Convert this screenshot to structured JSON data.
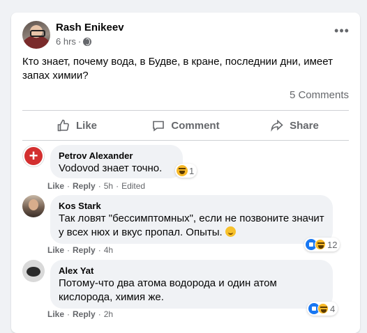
{
  "post": {
    "author": "Rash Enikeev",
    "time": "6 hrs",
    "separator": "·",
    "text": "Кто знает, почему вода, в Будве, в кране, последнии дни, имеет запах химии?",
    "comment_count": "5 Comments",
    "more_label": "•••"
  },
  "actions": {
    "like": "Like",
    "comment": "Comment",
    "share": "Share"
  },
  "comments": [
    {
      "name": "Petrov Alexander",
      "text": "Vodovod знает точно.",
      "reaction_count": "1",
      "like": "Like",
      "reply": "Reply",
      "time": "5h",
      "edited": "Edited"
    },
    {
      "name": "Kos Stark",
      "text": "Так ловят \"бессимптомных\", если не позвоните значит у всех нюх и вкус пропал. Опыты.",
      "reaction_count": "12",
      "like": "Like",
      "reply": "Reply",
      "time": "4h"
    },
    {
      "name": "Alex Yat",
      "text": "Потому-что два атома водорода и один атом кислорода, химия же.",
      "reaction_count": "4",
      "like": "Like",
      "reply": "Reply",
      "time": "2h"
    }
  ],
  "colors": {
    "background": "#f0f2f5",
    "card": "#ffffff",
    "secondary_text": "#65676b",
    "like_blue": "#1877f2",
    "haha_yellow": "#f7b928"
  }
}
